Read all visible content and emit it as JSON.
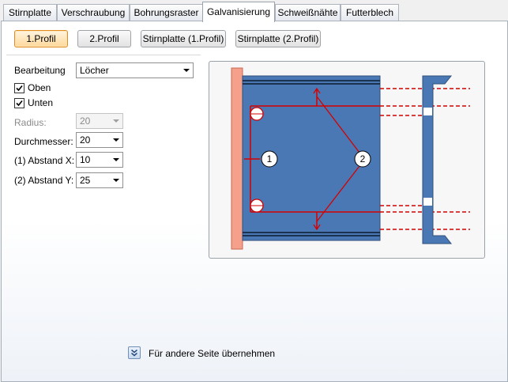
{
  "tabs": [
    {
      "label": "Stirnplatte",
      "active": false
    },
    {
      "label": "Verschraubung",
      "active": false
    },
    {
      "label": "Bohrungsraster",
      "active": false
    },
    {
      "label": "Galvanisierung",
      "active": true
    },
    {
      "label": "Schweißnähte",
      "active": false
    },
    {
      "label": "Futterblech",
      "active": false
    }
  ],
  "profile_buttons": [
    {
      "label": "1.Profil",
      "active": true
    },
    {
      "label": "2.Profil",
      "active": false
    },
    {
      "label": "Stirnplatte (1.Profil)",
      "active": false
    },
    {
      "label": "Stirnplatte (2.Profil)",
      "active": false
    }
  ],
  "form": {
    "bearbeitung_label": "Bearbeitung",
    "bearbeitung_value": "Löcher",
    "oben_label": "Oben",
    "oben_checked": true,
    "unten_label": "Unten",
    "unten_checked": true,
    "radius_label": "Radius:",
    "radius_value": "20",
    "durchmesser_label": "Durchmesser:",
    "durchmesser_value": "20",
    "abstand_x_label": "(1) Abstand X:",
    "abstand_x_value": "10",
    "abstand_y_label": "(2) Abstand Y:",
    "abstand_y_value": "25"
  },
  "preview": {
    "callout_1": "1",
    "callout_2": "2",
    "plate_color": "#f4a08a",
    "beam_color": "#4a78b4",
    "dim_color": "#d40000"
  },
  "footer": {
    "apply_other_side_label": "Für andere Seite übernehmen"
  }
}
